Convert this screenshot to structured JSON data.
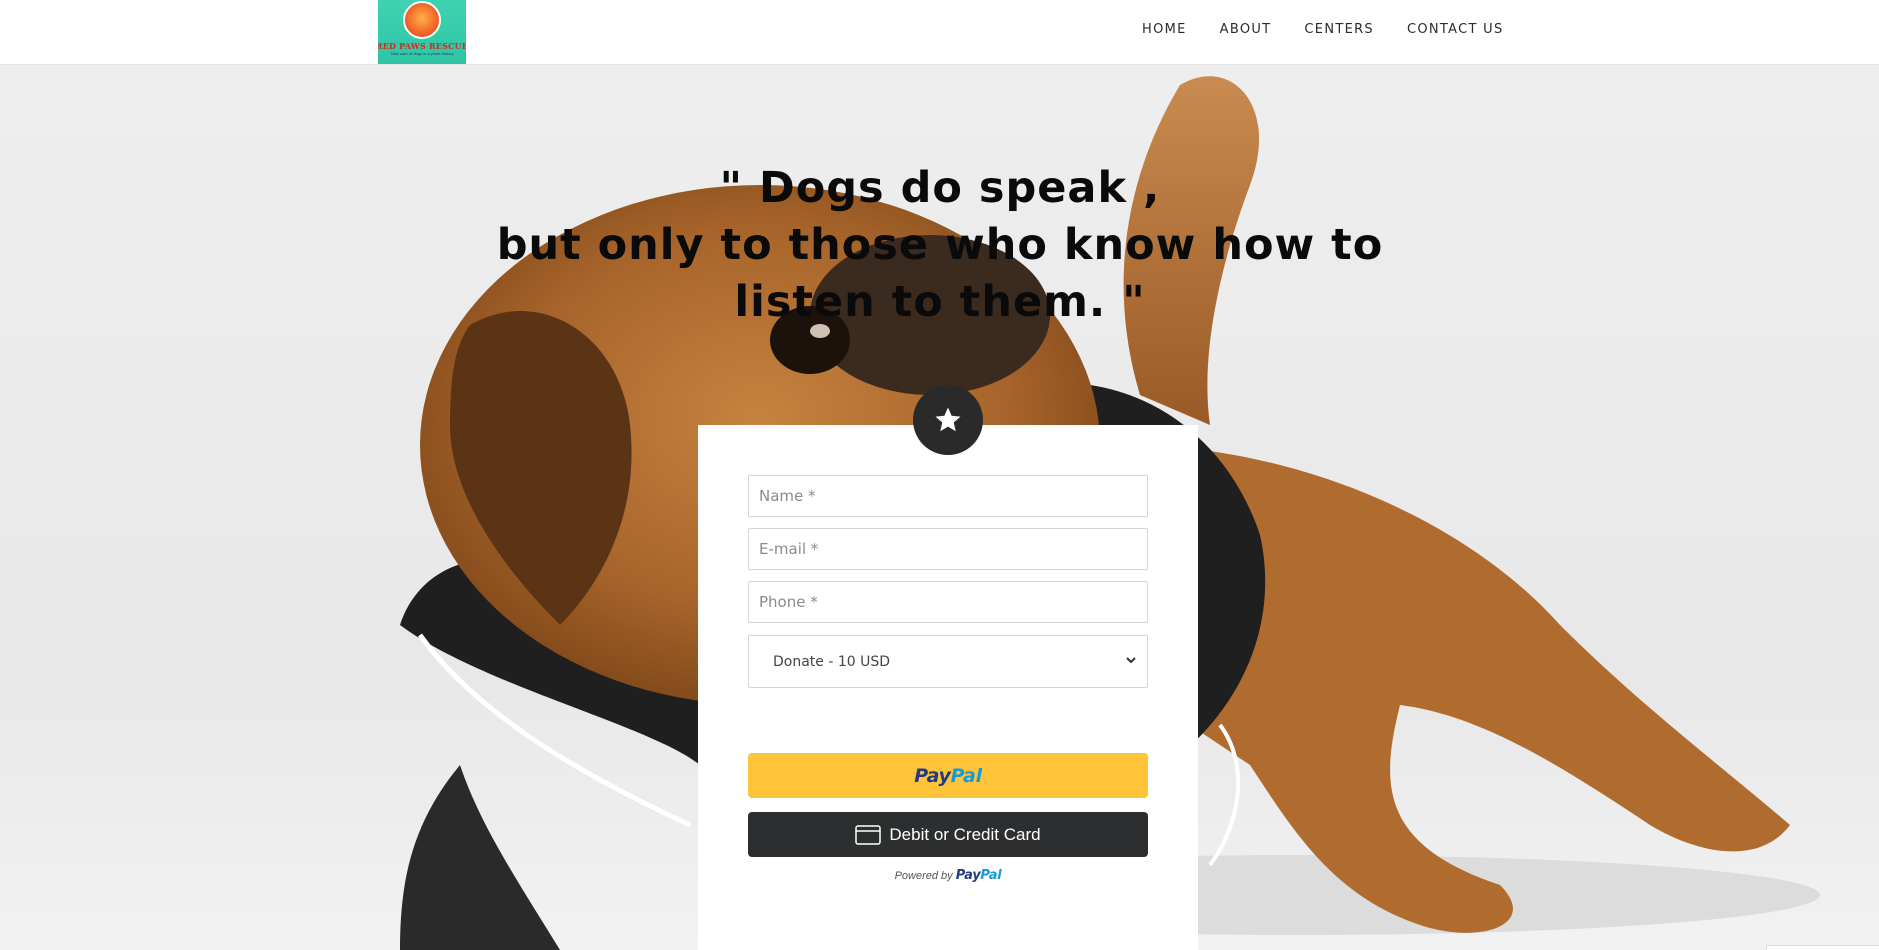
{
  "header": {
    "logo": {
      "title": "RED PAWS RESCUE",
      "subtitle": "Take care of dogs in a pirate history"
    },
    "nav": [
      {
        "label": "HOME"
      },
      {
        "label": "ABOUT"
      },
      {
        "label": "CENTERS"
      },
      {
        "label": "CONTACT US"
      }
    ]
  },
  "hero": {
    "quote_lines": [
      "\" Dogs do speak ,",
      "but only to those who know how to",
      "listen to them. \""
    ]
  },
  "form": {
    "badge_icon": "star-icon",
    "name_placeholder": "Name *",
    "email_placeholder": "E-mail *",
    "phone_placeholder": "Phone *",
    "donation_select": {
      "selected": "Donate - 10 USD"
    },
    "paypal_button": {
      "part1": "Pay",
      "part2": "Pal"
    },
    "card_button": {
      "label": "Debit or Credit Card",
      "icon": "credit-card-icon"
    },
    "powered_by": {
      "prefix": "Powered by",
      "brand_part1": "Pay",
      "brand_part2": "Pal"
    }
  },
  "colors": {
    "paypal_yellow": "#ffc439",
    "card_button": "#2c2e2f",
    "paypal_dark_blue": "#253b80",
    "paypal_light_blue": "#179bd7",
    "badge": "#2a2a2a"
  }
}
